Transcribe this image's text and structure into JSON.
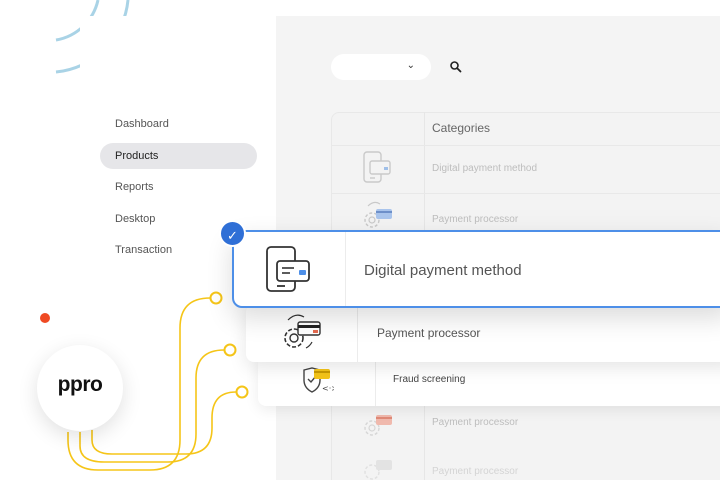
{
  "sidebar": {
    "items": [
      {
        "label": "Dashboard",
        "active": false
      },
      {
        "label": "Products",
        "active": true
      },
      {
        "label": "Reports",
        "active": false
      },
      {
        "label": "Desktop",
        "active": false
      },
      {
        "label": "Transaction",
        "active": false
      }
    ]
  },
  "toolbar": {
    "dropdown_value": "",
    "search_icon": "search-icon"
  },
  "table": {
    "header": "Categories",
    "rows": [
      {
        "label": "Digital payment method",
        "icon": "phone-card-icon"
      },
      {
        "label": "Payment processor",
        "icon": "gear-card-icon"
      },
      {
        "label": "Payment processor",
        "icon": "gear-card-icon"
      },
      {
        "label": "Payment processor",
        "icon": "gear-card-icon"
      }
    ]
  },
  "cards": {
    "selected": {
      "label": "Digital payment method",
      "icon": "phone-card-icon"
    },
    "second": {
      "label": "Payment processor",
      "icon": "gear-card-icon"
    },
    "third": {
      "label": "Fraud screening",
      "icon": "shield-card-icon"
    }
  },
  "brand": {
    "logo_text": "ppro",
    "accent": "#2f6fd6",
    "connector": "#f5c518",
    "dot": "#ef4a23",
    "arc": "#a9d3e6"
  }
}
